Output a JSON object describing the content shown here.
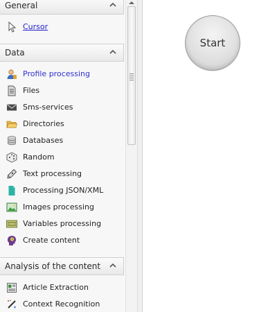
{
  "sections": [
    {
      "title": "General",
      "items": [
        {
          "label": "Cursor",
          "icon": "cursor-arrow-icon"
        }
      ]
    },
    {
      "title": "Data",
      "items": [
        {
          "label": "Profile processing",
          "icon": "profile-icon"
        },
        {
          "label": "Files",
          "icon": "file-icon"
        },
        {
          "label": "Sms-services",
          "icon": "envelope-icon"
        },
        {
          "label": "Directories",
          "icon": "folder-icon"
        },
        {
          "label": "Databases",
          "icon": "database-icon"
        },
        {
          "label": "Random",
          "icon": "dice-icon"
        },
        {
          "label": "Text processing",
          "icon": "pen-icon"
        },
        {
          "label": "Processing JSON/XML",
          "icon": "document-teal-icon"
        },
        {
          "label": "Images processing",
          "icon": "image-icon"
        },
        {
          "label": "Variables processing",
          "icon": "variables-icon"
        },
        {
          "label": "Create content",
          "icon": "head-icon"
        }
      ]
    },
    {
      "title": "Analysis of the content",
      "items": [
        {
          "label": "Article Extraction",
          "icon": "article-icon"
        },
        {
          "label": "Context Recognition",
          "icon": "magic-wand-icon"
        }
      ]
    }
  ],
  "canvas": {
    "start_label": "Start"
  },
  "colors": {
    "link": "#1d1dcc",
    "active": "#2f2fd0",
    "header_bg": "#efefef"
  }
}
